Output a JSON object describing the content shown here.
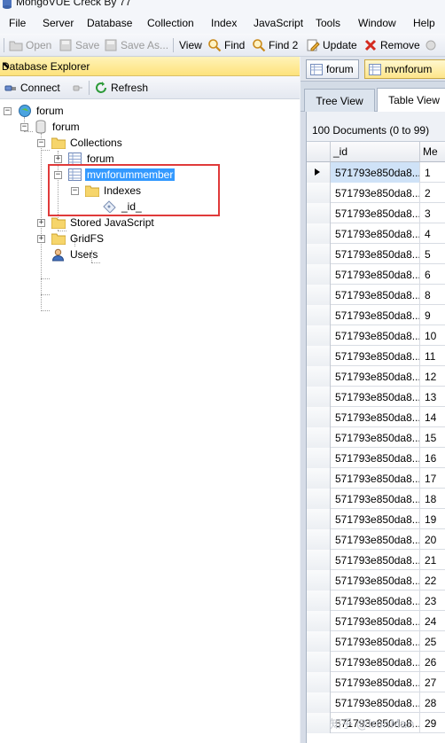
{
  "window": {
    "title": "MongoVUE Creck By 77"
  },
  "menu": [
    {
      "label": "File"
    },
    {
      "label": "Server"
    },
    {
      "label": "Database"
    },
    {
      "label": "Collection"
    },
    {
      "label": "Index"
    },
    {
      "label": "JavaScript"
    },
    {
      "label": "Tools"
    },
    {
      "label": "Window"
    },
    {
      "label": "Help"
    }
  ],
  "toolbar": {
    "open": "Open",
    "save": "Save",
    "save_as": "Save As...",
    "view": "View",
    "find": "Find",
    "find2": "Find 2",
    "update": "Update",
    "remove": "Remove"
  },
  "explorer": {
    "title": "Database Explorer",
    "connect": "Connect",
    "refresh": "Refresh",
    "tree": {
      "server": "forum",
      "database": "forum",
      "collections": "Collections",
      "collection_forum": "forum",
      "collection_member": "mvnforummember",
      "indexes": "Indexes",
      "index_id": "_id_",
      "stored_js": "Stored JavaScript",
      "gridfs": "GridFS",
      "users": "Users"
    }
  },
  "doc_tabs": {
    "tab1": "forum",
    "tab2": "mvnforum"
  },
  "view_tabs": {
    "tree": "Tree View",
    "table": "Table View"
  },
  "grid": {
    "summary": "100 Documents (0 to 99)",
    "col_id": "_id",
    "col_2": "Me",
    "rows": [
      {
        "id": "571793e850da8...",
        "v": "1"
      },
      {
        "id": "571793e850da8...",
        "v": "2"
      },
      {
        "id": "571793e850da8...",
        "v": "3"
      },
      {
        "id": "571793e850da8...",
        "v": "4"
      },
      {
        "id": "571793e850da8...",
        "v": "5"
      },
      {
        "id": "571793e850da8...",
        "v": "6"
      },
      {
        "id": "571793e850da8...",
        "v": "8"
      },
      {
        "id": "571793e850da8...",
        "v": "9"
      },
      {
        "id": "571793e850da8...",
        "v": "10"
      },
      {
        "id": "571793e850da8...",
        "v": "11"
      },
      {
        "id": "571793e850da8...",
        "v": "12"
      },
      {
        "id": "571793e850da8...",
        "v": "13"
      },
      {
        "id": "571793e850da8...",
        "v": "14"
      },
      {
        "id": "571793e850da8...",
        "v": "15"
      },
      {
        "id": "571793e850da8...",
        "v": "16"
      },
      {
        "id": "571793e850da8...",
        "v": "17"
      },
      {
        "id": "571793e850da8...",
        "v": "18"
      },
      {
        "id": "571793e850da8...",
        "v": "19"
      },
      {
        "id": "571793e850da8...",
        "v": "20"
      },
      {
        "id": "571793e850da8...",
        "v": "21"
      },
      {
        "id": "571793e850da8...",
        "v": "22"
      },
      {
        "id": "571793e850da8...",
        "v": "23"
      },
      {
        "id": "571793e850da8...",
        "v": "24"
      },
      {
        "id": "571793e850da8...",
        "v": "25"
      },
      {
        "id": "571793e850da8...",
        "v": "26"
      },
      {
        "id": "571793e850da8...",
        "v": "27"
      },
      {
        "id": "571793e850da8...",
        "v": "28"
      },
      {
        "id": "571793e850da8...",
        "v": "29"
      }
    ]
  },
  "watermark": "知乎 @IronMan"
}
